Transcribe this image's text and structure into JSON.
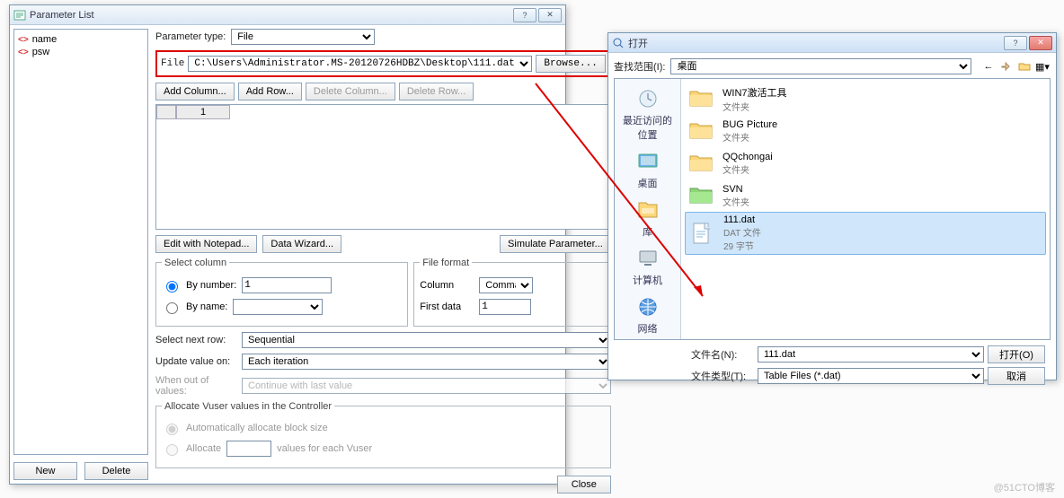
{
  "paramWindow": {
    "title": "Parameter List",
    "tree": [
      "name",
      "psw"
    ],
    "paramTypeLabel": "Parameter type:",
    "paramTypeValue": "File",
    "fileLabel": "File",
    "filePath": "C:\\Users\\Administrator.MS-20120726HDBZ\\Desktop\\111.dat",
    "browse": "Browse...",
    "addColumn": "Add Column...",
    "addRow": "Add Row...",
    "deleteColumn": "Delete Column...",
    "deleteRow": "Delete Row...",
    "gridCol1": "1",
    "editWithNotepad": "Edit with Notepad...",
    "dataWizard": "Data Wizard...",
    "simulateParam": "Simulate Parameter...",
    "selectColumn": {
      "legend": "Select column",
      "byNumberLabel": "By number:",
      "byNumberValue": "1",
      "byNameLabel": "By name:",
      "byNameValue": ""
    },
    "fileFormat": {
      "legend": "File format",
      "columnLabel": "Column",
      "columnValue": "Comma",
      "firstLabel": "First data",
      "firstValue": "1"
    },
    "selectNextRowLabel": "Select next row:",
    "selectNextRowValue": "Sequential",
    "updateValueLabel": "Update value on:",
    "updateValueValue": "Each iteration",
    "whenOutLabel": "When out of values:",
    "whenOutValue": "Continue with last value",
    "allocate": {
      "legend": "Allocate Vuser values in the Controller",
      "auto": "Automatically allocate block size",
      "alloc": "Allocate",
      "allocValue": "",
      "allocSuffix": "values for each Vuser"
    },
    "newBtn": "New",
    "deleteBtn": "Delete",
    "close": "Close"
  },
  "openDialog": {
    "title": "打开",
    "lookInLabel": "查找范围(I):",
    "lookInValue": "桌面",
    "places": [
      {
        "label": "最近访问的位置"
      },
      {
        "label": "桌面"
      },
      {
        "label": "库"
      },
      {
        "label": "计算机"
      },
      {
        "label": "网络"
      }
    ],
    "files": [
      {
        "name": "WIN7激活工具",
        "sub": "文件夹",
        "type": "folder"
      },
      {
        "name": "BUG Picture",
        "sub": "文件夹",
        "type": "folder"
      },
      {
        "name": "QQchongai",
        "sub": "文件夹",
        "type": "folder"
      },
      {
        "name": "SVN",
        "sub": "文件夹",
        "type": "folder-green"
      },
      {
        "name": "111.dat",
        "sub": "DAT 文件",
        "sub2": "29 字节",
        "type": "file",
        "selected": true
      }
    ],
    "fileNameLabel": "文件名(N):",
    "fileNameValue": "111.dat",
    "fileTypeLabel": "文件类型(T):",
    "fileTypeValue": "Table Files (*.dat)",
    "open": "打开(O)",
    "cancel": "取消"
  },
  "watermark": "@51CTO博客"
}
